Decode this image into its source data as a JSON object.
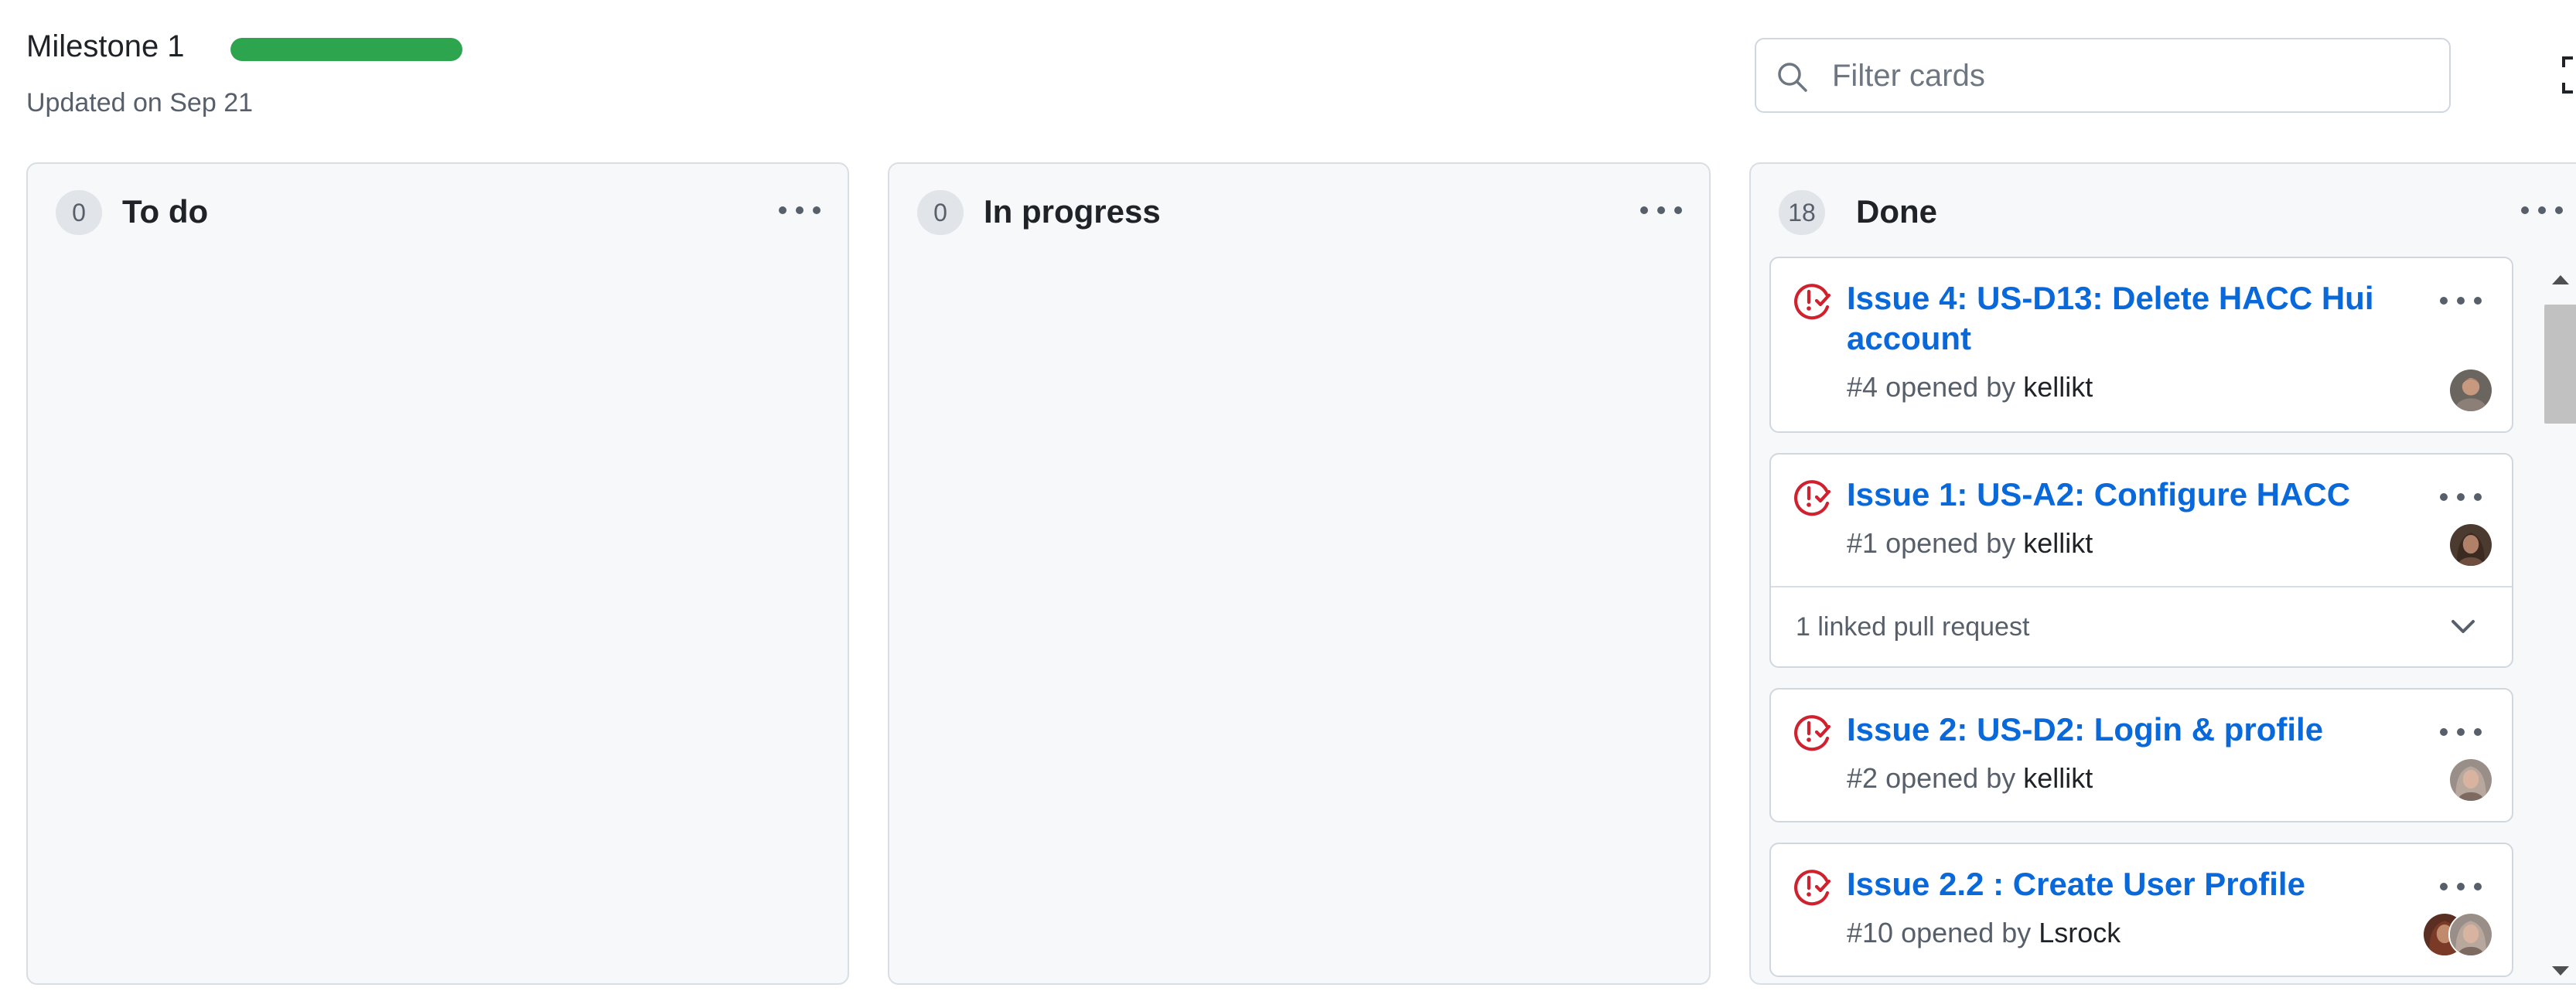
{
  "milestone": {
    "title": "Milestone 1",
    "progress_percent": 100,
    "updated": "Updated on Sep 21"
  },
  "filter": {
    "placeholder": "Filter cards",
    "value": ""
  },
  "colors": {
    "issue_icon": "#cf222e",
    "progress": "#2da44e",
    "link": "#0969da"
  },
  "columns": [
    {
      "count": "0",
      "name": "To do"
    },
    {
      "count": "0",
      "name": "In progress"
    },
    {
      "count": "18",
      "name": "Done"
    }
  ],
  "cards": [
    {
      "title": "Issue 4: US-D13: Delete HACC Hui account",
      "number": "#4",
      "opened_by": "opened by",
      "author": "kellikt",
      "icon": "issue-closed-icon"
    },
    {
      "title": "Issue 1: US-A2: Configure HACC",
      "number": "#1",
      "opened_by": "opened by",
      "author": "kellikt",
      "icon": "issue-closed-icon",
      "footer": "1 linked pull request"
    },
    {
      "title": "Issue 2: US-D2: Login & profile",
      "number": "#2",
      "opened_by": "opened by",
      "author": "kellikt",
      "icon": "issue-closed-icon"
    },
    {
      "title": "Issue 2.2 : Create User Profile",
      "number": "#10",
      "opened_by": "opened by",
      "author": "Lsrock",
      "icon": "issue-closed-icon"
    }
  ]
}
